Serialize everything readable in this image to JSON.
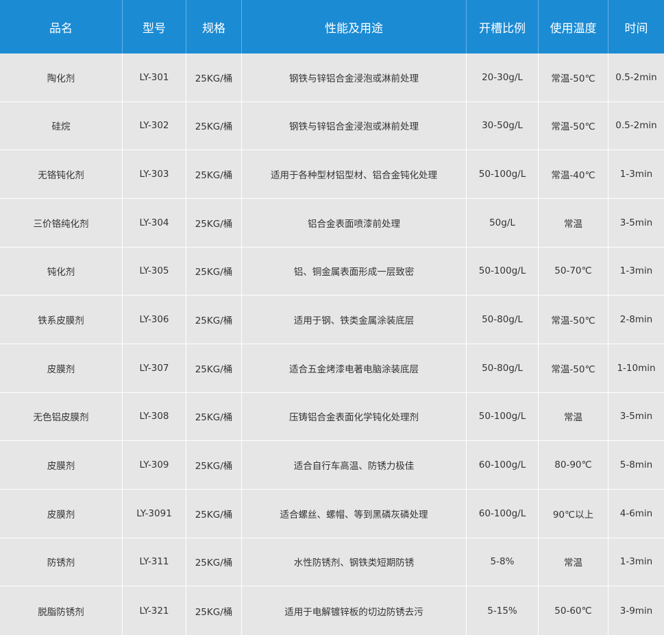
{
  "table": {
    "headers": [
      "品名",
      "型号",
      "规格",
      "性能及用途",
      "开槽比例",
      "使用温度",
      "时间"
    ],
    "rows": [
      [
        "陶化剂",
        "LY-301",
        "25KG/桶",
        "钢铁与锌铝合金浸泡或淋前处理",
        "20-30g/L",
        "常温-50℃",
        "0.5-2min"
      ],
      [
        "硅烷",
        "LY-302",
        "25KG/桶",
        "钢铁与锌铝合金浸泡或淋前处理",
        "30-50g/L",
        "常温-50℃",
        "0.5-2min"
      ],
      [
        "无铬钝化剂",
        "LY-303",
        "25KG/桶",
        "适用于各种型材铝型材、铝合金钝化处理",
        "50-100g/L",
        "常温-40℃",
        "1-3min"
      ],
      [
        "三价铬纯化剂",
        "LY-304",
        "25KG/桶",
        "铝合金表面喷漆前处理",
        "50g/L",
        "常温",
        "3-5min"
      ],
      [
        "钝化剂",
        "LY-305",
        "25KG/桶",
        "铝、铜金属表面形成一层致密",
        "50-100g/L",
        "50-70℃",
        "1-3min"
      ],
      [
        "铁系皮膜剂",
        "LY-306",
        "25KG/桶",
        "适用于钢、铁类金属涂装底层",
        "50-80g/L",
        "常温-50℃",
        "2-8min"
      ],
      [
        "皮膜剂",
        "LY-307",
        "25KG/桶",
        "适合五金烤漆电著电脑涂装底层",
        "50-80g/L",
        "常温-50℃",
        "1-10min"
      ],
      [
        "无色铝皮膜剂",
        "LY-308",
        "25KG/桶",
        "压铸铝合金表面化学钝化处理剂",
        "50-100g/L",
        "常温",
        "3-5min"
      ],
      [
        "皮膜剂",
        "LY-309",
        "25KG/桶",
        "适合自行车高温、防锈力极佳",
        "60-100g/L",
        "80-90℃",
        "5-8min"
      ],
      [
        "皮膜剂",
        "LY-3091",
        "25KG/桶",
        "适合螺丝、螺帽、等到黑磷灰磷处理",
        "60-100g/L",
        "90℃以上",
        "4-6min"
      ],
      [
        "防锈剂",
        "LY-311",
        "25KG/桶",
        "水性防锈剂、钢铁类短期防锈",
        "5-8%",
        "常温",
        "1-3min"
      ],
      [
        "脱脂防锈剂",
        "LY-321",
        "25KG/桶",
        "适用于电解镀锌板的切边防锈去污",
        "5-15%",
        "50-60℃",
        "3-9min"
      ]
    ]
  },
  "colors": {
    "header_bg": "#1b8bd4",
    "header_text": "#ffffff",
    "row_bg": "#e6e6e6",
    "row_text": "#333333",
    "divider": "#ffffff"
  }
}
